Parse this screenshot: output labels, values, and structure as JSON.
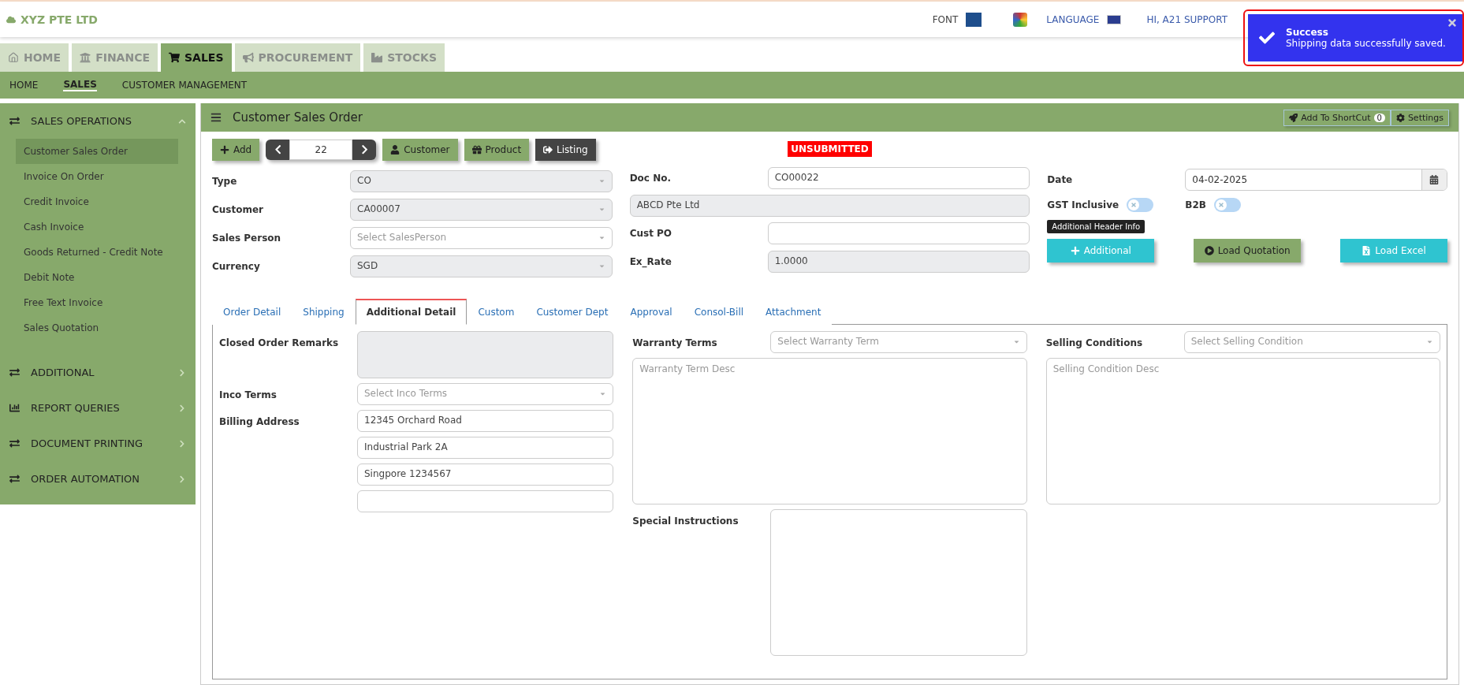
{
  "header": {
    "company": "XYZ PTE LTD",
    "font_label": "FONT",
    "language_label": "LANGUAGE",
    "user": "HI, A21 SUPPORT"
  },
  "toast": {
    "title": "Success",
    "message": "Shipping data successfully saved."
  },
  "module_tabs": [
    {
      "label": "HOME",
      "kind": "home",
      "selected": false
    },
    {
      "label": "FINANCE",
      "kind": "bank",
      "selected": false
    },
    {
      "label": "SALES",
      "kind": "cart",
      "selected": true
    },
    {
      "label": "PROCUREMENT",
      "kind": "megaphone",
      "selected": false
    },
    {
      "label": "STOCKS",
      "kind": "factory",
      "selected": false
    }
  ],
  "subnav": [
    {
      "label": "HOME",
      "selected": false
    },
    {
      "label": "SALES",
      "selected": true
    },
    {
      "label": "CUSTOMER MANAGEMENT",
      "selected": false
    }
  ],
  "sidebar": {
    "sections": [
      {
        "label": "SALES OPERATIONS",
        "kind": "exchange",
        "expanded": true,
        "items": [
          {
            "label": "Customer Sales Order",
            "selected": true
          },
          {
            "label": "Invoice On Order",
            "selected": false
          },
          {
            "label": "Credit Invoice",
            "selected": false
          },
          {
            "label": "Cash Invoice",
            "selected": false
          },
          {
            "label": "Goods Returned - Credit Note",
            "selected": false
          },
          {
            "label": "Debit Note",
            "selected": false
          },
          {
            "label": "Free Text Invoice",
            "selected": false
          },
          {
            "label": "Sales Quotation",
            "selected": false
          }
        ]
      },
      {
        "label": "ADDITIONAL",
        "kind": "exchange",
        "expanded": false
      },
      {
        "label": "REPORT QUERIES",
        "kind": "chart",
        "expanded": false
      },
      {
        "label": "DOCUMENT PRINTING",
        "kind": "exchange",
        "expanded": false
      },
      {
        "label": "ORDER AUTOMATION",
        "kind": "exchange",
        "expanded": false
      }
    ]
  },
  "page": {
    "title": "Customer Sales Order",
    "shortcut_button": "Add To ShortCut",
    "shortcut_count": "0",
    "settings_button": "Settings"
  },
  "toolbar": {
    "add": "Add",
    "record_number": "22",
    "customer": "Customer",
    "product": "Product",
    "listing": "Listing"
  },
  "status_badge": "UNSUBMITTED",
  "left_fields": [
    {
      "label": "Type",
      "value": "CO",
      "disabled": true
    },
    {
      "label": "Customer",
      "value": "CA00007",
      "disabled": true
    },
    {
      "label": "Sales Person",
      "placeholder": "Select SalesPerson",
      "disabled": false
    },
    {
      "label": "Currency",
      "value": "SGD",
      "disabled": true
    }
  ],
  "middle_fields": [
    {
      "label": "Doc No.",
      "value": "CO00022",
      "disabled": false
    },
    {
      "value": "ABCD Pte Ltd",
      "disabled": true
    },
    {
      "label": "Cust PO",
      "disabled": false
    },
    {
      "label": "Ex_Rate",
      "value": "1.0000",
      "disabled": true
    }
  ],
  "date": {
    "label": "Date",
    "value": "04-02-2025"
  },
  "toggles": [
    {
      "label": "GST Inclusive",
      "on": false
    },
    {
      "label": "B2B",
      "on": false
    }
  ],
  "tooltip": "Additional Header Info",
  "action_buttons": [
    {
      "label": "Additional",
      "kind": "additional"
    },
    {
      "label": "Load Quotation",
      "kind": "quotation"
    },
    {
      "label": "Load Excel",
      "kind": "excel"
    }
  ],
  "detail_tabs": [
    {
      "label": "Order Detail",
      "selected": false
    },
    {
      "label": "Shipping",
      "selected": false
    },
    {
      "label": "Additional Detail",
      "selected": true
    },
    {
      "label": "Custom",
      "selected": false
    },
    {
      "label": "Customer Dept",
      "selected": false
    },
    {
      "label": "Approval",
      "selected": false
    },
    {
      "label": "Consol-Bill",
      "selected": false
    },
    {
      "label": "Attachment",
      "selected": false
    }
  ],
  "additional_detail": {
    "closed_order_remarks": {
      "label": "Closed Order Remarks",
      "disabled": true
    },
    "inco_terms": {
      "label": "Inco Terms",
      "placeholder": "Select Inco Terms"
    },
    "billing_address": {
      "label": "Billing Address",
      "lines": [
        {
          "kind": "filled",
          "value": "12345 Orchard Road"
        },
        {
          "kind": "filled",
          "value": "Industrial Park 2A"
        },
        {
          "kind": "filled",
          "value": "Singpore 1234567"
        },
        {
          "kind": "empty"
        }
      ]
    },
    "warranty_terms": {
      "label": "Warranty Terms",
      "placeholder": "Select Warranty Term",
      "desc_placeholder": "Warranty Term Desc"
    },
    "special_instructions": {
      "label": "Special Instructions"
    },
    "selling_conditions": {
      "label": "Selling Conditions",
      "placeholder": "Select Selling Condition",
      "desc_placeholder": "Selling Condition Desc"
    }
  }
}
